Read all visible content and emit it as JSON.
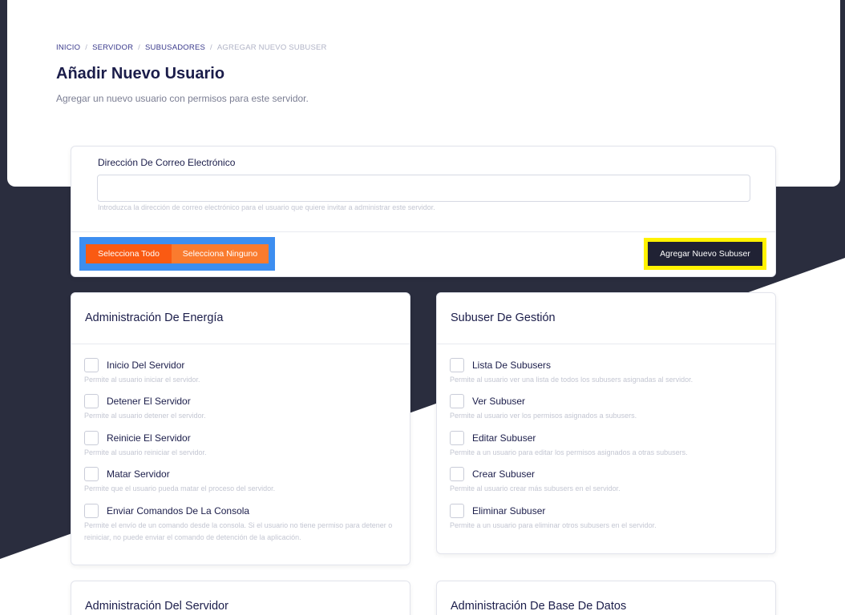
{
  "breadcrumb": [
    "INICIO",
    "SERVIDOR",
    "SUBUSADORES",
    "AGREGAR NUEVO SUBUSER"
  ],
  "page": {
    "title": "Añadir Nuevo Usuario",
    "subtitle": "Agregar un nuevo usuario con permisos para este servidor."
  },
  "email": {
    "label": "Dirección De Correo Electrónico",
    "value": "",
    "help": "Introduzca la dirección de correo electrónico para el usuario que quiere invitar a administrar este servidor."
  },
  "actions": {
    "select_all": "Selecciona Todo",
    "select_none": "Selecciona Ninguno",
    "add_subuser": "Agregar Nuevo Subuser"
  },
  "sections": [
    {
      "title": "Administración De Energía",
      "items": [
        {
          "name": "Inicio Del Servidor",
          "desc": "Permite al usuario iniciar el servidor."
        },
        {
          "name": "Detener El Servidor",
          "desc": "Permite al usuario detener el servidor."
        },
        {
          "name": "Reinicie El Servidor",
          "desc": "Permite al usuario reiniciar el servidor."
        },
        {
          "name": "Matar Servidor",
          "desc": "Permite que el usuario pueda matar el proceso del servidor."
        },
        {
          "name": "Enviar Comandos De La Consola",
          "desc": "Permite el envío de un comando desde la consola. Si el usuario no tiene permiso para detener o reiniciar, no puede enviar el comando de detención de la aplicación."
        }
      ]
    },
    {
      "title": "Subuser De Gestión",
      "items": [
        {
          "name": "Lista De Subusers",
          "desc": "Permite al usuario ver una lista de todos los subusers asignadas al servidor."
        },
        {
          "name": "Ver Subuser",
          "desc": "Permite al usuario ver los permisos asignados a subusers."
        },
        {
          "name": "Editar Subuser",
          "desc": "Permite a un usuario para editar los permisos asignados a otras subusers."
        },
        {
          "name": "Crear Subuser",
          "desc": "Permite al usuario crear más subusers en el servidor."
        },
        {
          "name": "Eliminar Subuser",
          "desc": "Permite a un usuario para eliminar otros subusers en el servidor."
        }
      ]
    },
    {
      "title": "Administración Del Servidor",
      "items": []
    },
    {
      "title": "Administración De Base De Datos",
      "items": []
    }
  ],
  "colors": {
    "accent_orange": "#fa5a12",
    "accent_orange_light": "#fa7b2e",
    "highlight_blue": "#3d8ef0",
    "highlight_yellow": "#fff200",
    "dark_button": "#202234",
    "background_dark": "#2a2d3e"
  }
}
